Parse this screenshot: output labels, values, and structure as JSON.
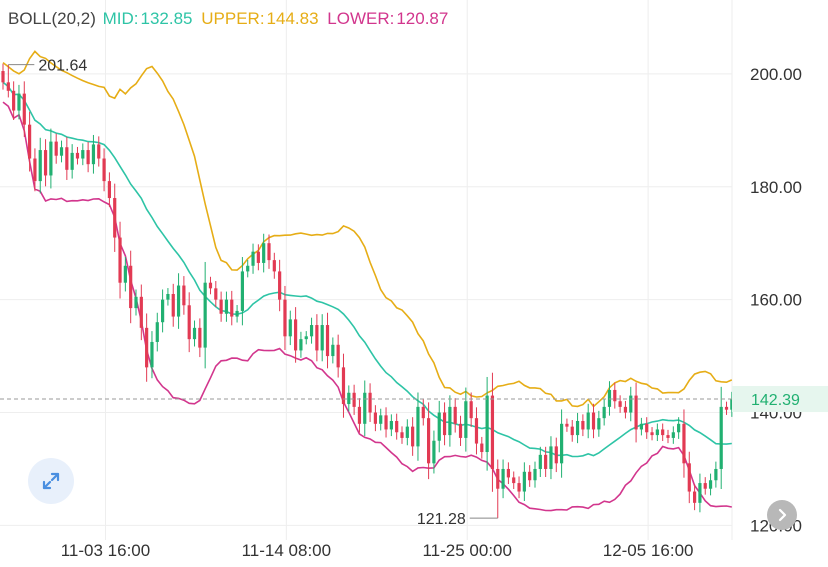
{
  "legend": {
    "boll": "BOLL(20,2)",
    "mid_label": "MID:",
    "mid_value": "132.85",
    "upper_label": "UPPER:",
    "upper_value": "144.83",
    "lower_label": "LOWER:",
    "lower_value": "120.87"
  },
  "colors": {
    "mid": "#2ec4a6",
    "upper": "#e6ad16",
    "lower": "#d2368d",
    "up": "#21b071",
    "down": "#e23a53",
    "grid": "#eeeeee",
    "current": "#9a9a9a",
    "boll_label": "#444444"
  },
  "icons": {
    "expand": "expand-diagonal-icon",
    "more": "chevron-right-icon"
  },
  "chart_data": {
    "type": "candlestick",
    "x_tick_labels": [
      "11-03 16:00",
      "11-14 08:00",
      "11-25 00:00",
      "12-05 16:00"
    ],
    "x_tick_positions": [
      14,
      48,
      82,
      116
    ],
    "y_ticks": [
      120.0,
      140.0,
      160.0,
      180.0,
      200.0
    ],
    "y_tick_labels": [
      "120.00",
      "140.00",
      "160.00",
      "180.00",
      "200.00"
    ],
    "ylim": [
      118.3,
      206.0
    ],
    "current_price": 142.39,
    "current_price_label": "142.39",
    "high_annotation": {
      "value": 201.64,
      "label": "201.64",
      "index": 1
    },
    "low_annotation": {
      "value": 121.28,
      "label": "121.28",
      "index": 93
    },
    "grid": true,
    "bollinger": {
      "period": 20,
      "k": 2
    },
    "closes": [
      198.5,
      197.0,
      193.5,
      196.5,
      191.0,
      185.0,
      181.0,
      186.5,
      182.0,
      188.0,
      185.5,
      187.0,
      183.0,
      186.0,
      185.0,
      186.5,
      184.0,
      187.5,
      185.0,
      181.0,
      178.0,
      171.0,
      163.0,
      166.0,
      158.5,
      160.5,
      155.0,
      148.0,
      152.5,
      156.0,
      160.0,
      161.0,
      157.0,
      162.5,
      159.0,
      153.0,
      155.0,
      151.5,
      163.0,
      162.0,
      160.0,
      157.5,
      160.0,
      157.0,
      158.0,
      165.0,
      166.0,
      168.5,
      166.5,
      170.0,
      167.0,
      165.0,
      160.0,
      153.5,
      156.5,
      151.0,
      153.0,
      153.5,
      155.5,
      151.0,
      155.5,
      150.0,
      152.0,
      148.0,
      141.5,
      143.5,
      141.0,
      138.0,
      143.5,
      140.0,
      138.0,
      139.5,
      137.0,
      138.5,
      136.5,
      135.5,
      137.5,
      134.0,
      141.0,
      139.0,
      131.0,
      135.0,
      140.0,
      136.0,
      141.0,
      138.0,
      135.5,
      142.0,
      139.0,
      134.5,
      133.0,
      143.0,
      130.0,
      126.5,
      130.0,
      128.5,
      127.5,
      126.0,
      129.5,
      128.0,
      130.0,
      132.5,
      130.0,
      134.0,
      131.0,
      138.0,
      137.5,
      136.0,
      138.5,
      137.0,
      140.0,
      137.0,
      139.0,
      141.0,
      144.0,
      142.0,
      141.0,
      140.0,
      143.0,
      137.0,
      138.0,
      136.5,
      136.0,
      137.0,
      136.0,
      135.5,
      136.5,
      138.0,
      131.0,
      126.0,
      124.0,
      127.5,
      126.5,
      128.0,
      130.0,
      141.0,
      140.5,
      142.39
    ]
  }
}
